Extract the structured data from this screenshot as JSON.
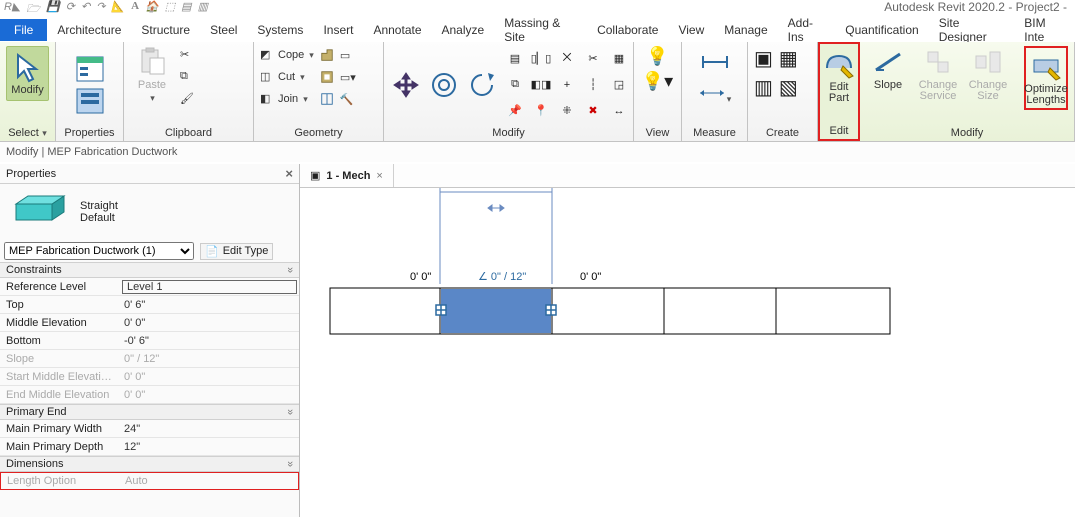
{
  "app": {
    "title": "Autodesk Revit 2020.2 - Project2 -"
  },
  "menu": {
    "file": "File",
    "tabs": [
      "Architecture",
      "Structure",
      "Steel",
      "Systems",
      "Insert",
      "Annotate",
      "Analyze",
      "Massing & Site",
      "Collaborate",
      "View",
      "Manage",
      "Add-Ins",
      "Quantification",
      "Site Designer",
      "BIM Inte"
    ]
  },
  "ribbon": {
    "select": {
      "modify": "Modify",
      "select": "Select"
    },
    "properties": {
      "label": "Properties",
      "btn": "Properties"
    },
    "clipboard": {
      "label": "Clipboard",
      "paste": "Paste",
      "cope": "Cope",
      "cut": "Cut",
      "join": "Join"
    },
    "geometry": {
      "label": "Geometry",
      "wall": "Wall"
    },
    "modify": {
      "label": "Modify"
    },
    "view": {
      "label": "View"
    },
    "measure": {
      "label": "Measure"
    },
    "create": {
      "label": "Create"
    },
    "edit": {
      "label": "Edit",
      "editpart": "Edit\nPart"
    },
    "modify2": {
      "label": "Modify",
      "slope": "Slope",
      "changeservice": "Change Service",
      "changesize": "Change Size",
      "optimize": "Optimize\nLengths"
    }
  },
  "infobar": {
    "text": "Modify | MEP Fabrication Ductwork"
  },
  "docTabs": {
    "name": "1 - Mech"
  },
  "properties": {
    "title": "Properties",
    "family": "Straight",
    "type": "Default",
    "selector": "MEP Fabrication Ductwork (1)",
    "edittype": "Edit Type",
    "constraints": {
      "label": "Constraints",
      "items": [
        {
          "k": "Reference Level",
          "v": "Level 1",
          "boxed": true
        },
        {
          "k": "Top",
          "v": "0'   6\""
        },
        {
          "k": "Middle Elevation",
          "v": "0'   0\""
        },
        {
          "k": "Bottom",
          "v": "-0'   6\""
        },
        {
          "k": "Slope",
          "v": "0\" / 12\"",
          "disabled": true
        },
        {
          "k": "Start Middle Elevati…",
          "v": "0'   0\"",
          "disabled": true
        },
        {
          "k": "End Middle Elevation",
          "v": "0'   0\"",
          "disabled": true
        }
      ]
    },
    "primary": {
      "label": "Primary End",
      "items": [
        {
          "k": " Main Primary Width",
          "v": "24\""
        },
        {
          "k": " Main Primary Depth",
          "v": "12\""
        }
      ]
    },
    "dimensions": {
      "label": "Dimensions",
      "items": [
        {
          "k": "Length Option",
          "v": "Auto",
          "disabled": true,
          "hl": true
        }
      ]
    }
  },
  "canvas": {
    "dims": {
      "left": "0'  0\"",
      "mid": "0\" / 12\"",
      "right": "0'  0\""
    }
  }
}
